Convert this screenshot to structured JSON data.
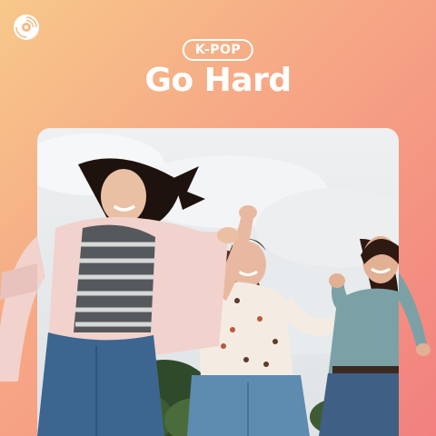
{
  "cover": {
    "genre_tag": "K-POP",
    "title": "Go Hard"
  },
  "icons": {
    "logo": "vinyl-disc-icon"
  },
  "colors": {
    "gradient_start": "#f7c88a",
    "gradient_end": "#f2807f",
    "text": "#ffffff"
  }
}
